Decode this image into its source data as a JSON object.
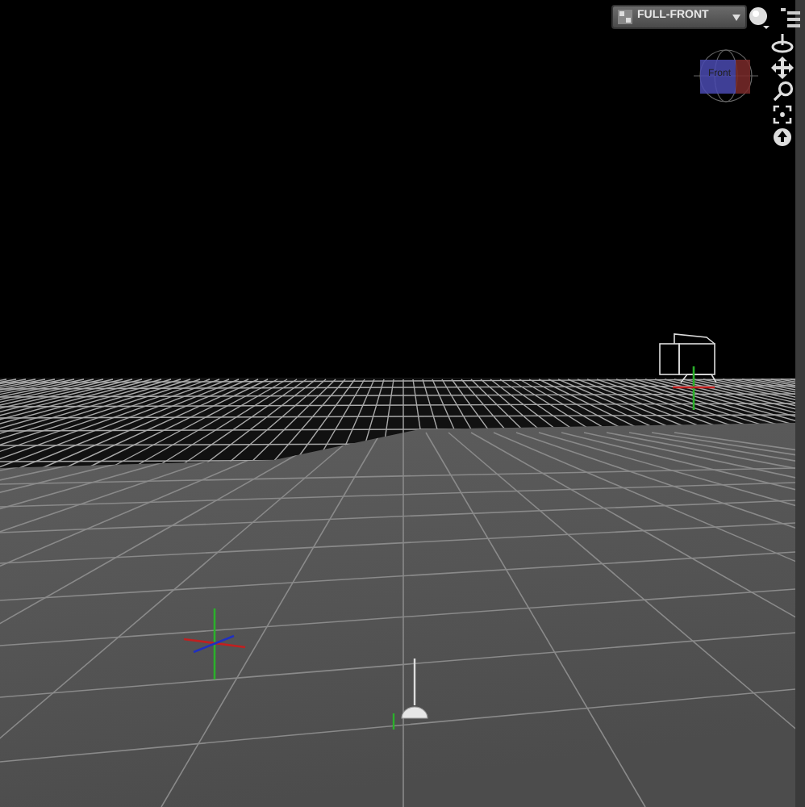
{
  "viewport": {
    "camera_menu": {
      "value": "FULL-FRONT"
    },
    "view_cube": {
      "face_label": "Front"
    }
  }
}
